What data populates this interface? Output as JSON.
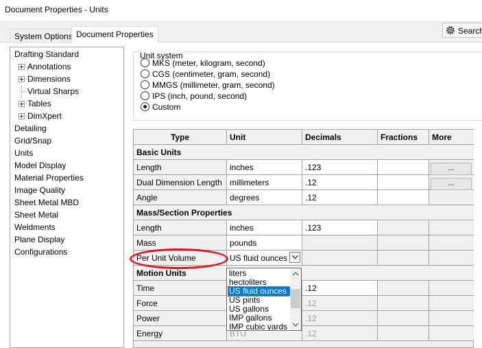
{
  "window": {
    "title": "Document Properties - Units"
  },
  "tabs": [
    {
      "label": "System Options"
    },
    {
      "label": "Document Properties"
    }
  ],
  "search": {
    "label": "Search",
    "icon": "gear-icon"
  },
  "tree": {
    "items": [
      {
        "label": "Drafting Standard",
        "level": 0,
        "expander": false
      },
      {
        "label": "Annotations",
        "level": 1,
        "expander": true
      },
      {
        "label": "Dimensions",
        "level": 1,
        "expander": true
      },
      {
        "label": "Virtual Sharps",
        "level": 1,
        "expander": false
      },
      {
        "label": "Tables",
        "level": 1,
        "expander": true
      },
      {
        "label": "DimXpert",
        "level": 1,
        "expander": true
      },
      {
        "label": "Detailing",
        "level": 0,
        "expander": false
      },
      {
        "label": "Grid/Snap",
        "level": 0,
        "expander": false
      },
      {
        "label": "Units",
        "level": 0,
        "expander": false,
        "selected": true
      },
      {
        "label": "Model Display",
        "level": 0,
        "expander": false
      },
      {
        "label": "Material Properties",
        "level": 0,
        "expander": false
      },
      {
        "label": "Image Quality",
        "level": 0,
        "expander": false
      },
      {
        "label": "Sheet Metal MBD",
        "level": 0,
        "expander": false
      },
      {
        "label": "Sheet Metal",
        "level": 0,
        "expander": false
      },
      {
        "label": "Weldments",
        "level": 0,
        "expander": false
      },
      {
        "label": "Plane Display",
        "level": 0,
        "expander": false
      },
      {
        "label": "Configurations",
        "level": 0,
        "expander": false
      }
    ]
  },
  "unit_system": {
    "legend": "Unit system",
    "options": [
      {
        "label": "MKS  (meter, kilogram, second)",
        "checked": false
      },
      {
        "label": "CGS  (centimeter, gram, second)",
        "checked": false
      },
      {
        "label": "MMGS  (millimeter, gram, second)",
        "checked": false
      },
      {
        "label": "IPS  (inch, pound, second)",
        "checked": false
      },
      {
        "label": "Custom",
        "checked": true
      }
    ]
  },
  "grid": {
    "columns": [
      "Type",
      "Unit",
      "Decimals",
      "Fractions",
      "More"
    ],
    "basic_units": {
      "title": "Basic Units",
      "rows": [
        {
          "type": "Length",
          "unit": "inches",
          "decimals": ".123",
          "more": "..."
        },
        {
          "type": "Dual Dimension Length",
          "unit": "millimeters",
          "decimals": ".12",
          "more": "..."
        },
        {
          "type": "Angle",
          "unit": "degrees",
          "decimals": ".12"
        }
      ]
    },
    "mass_section": {
      "title": "Mass/Section Properties",
      "rows": [
        {
          "type": "Length",
          "unit": "inches",
          "decimals": ".123"
        },
        {
          "type": "Mass",
          "unit": "pounds"
        },
        {
          "type": "Per Unit Volume",
          "unit": "US fluid ounces"
        }
      ]
    },
    "motion_units": {
      "title": "Motion Units",
      "rows": [
        {
          "type": "Time",
          "decimals": ".12"
        },
        {
          "type": "Force",
          "decimals": ".12"
        },
        {
          "type": "Power",
          "decimals": ".12"
        },
        {
          "type": "Energy",
          "unit": "BTU",
          "decimals": ".12"
        }
      ]
    }
  },
  "dropdown": {
    "options": [
      "liters",
      "hectoliters",
      "US fluid ounces",
      "US pints",
      "US gallons",
      "IMP gallons",
      "IMP cubic yards"
    ],
    "selected_index": 2
  },
  "colors": {
    "highlight_ellipse": "#e3101a",
    "selection": "#0078d7"
  }
}
